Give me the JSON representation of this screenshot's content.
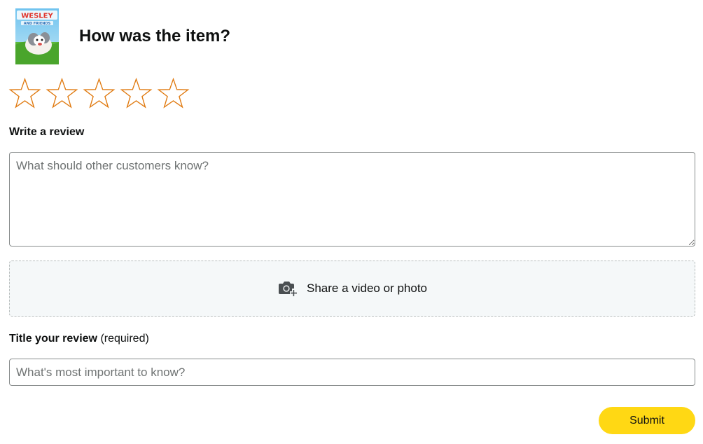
{
  "header": {
    "title": "How was the item?",
    "product_thumbnail": {
      "icon": "book-cover-thumbnail",
      "cover_text": "WESLEY",
      "cover_subtext": "AND FRIENDS"
    }
  },
  "rating": {
    "max": 5,
    "selected": 0,
    "star_color": "#e07a10"
  },
  "review": {
    "label": "Write a review",
    "placeholder": "What should other customers know?",
    "value": ""
  },
  "media_upload": {
    "icon": "camera-plus-icon",
    "label": "Share a video or photo"
  },
  "review_title": {
    "label": "Title your review",
    "label_suffix": "(required)",
    "placeholder": "What's most important to know?",
    "value": ""
  },
  "actions": {
    "submit_label": "Submit",
    "submit_color": "#ffd814"
  }
}
